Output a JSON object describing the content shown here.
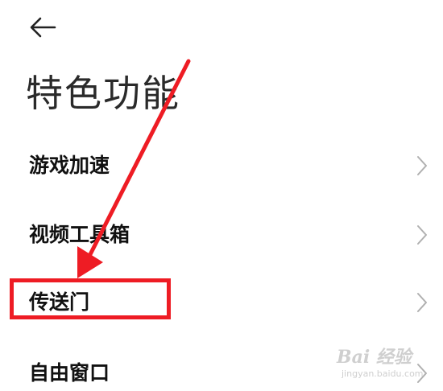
{
  "header": {
    "back_icon": "arrow-left-icon",
    "title": "特色功能"
  },
  "menu": {
    "items": [
      {
        "label": "游戏加速",
        "icon": "chevron-right-icon"
      },
      {
        "label": "视频工具箱",
        "icon": "chevron-right-icon"
      },
      {
        "label": "传送门",
        "icon": "chevron-right-icon",
        "highlighted": true
      },
      {
        "label": "自由窗口",
        "icon": "chevron-right-icon"
      }
    ]
  },
  "annotation": {
    "color": "#ee1c24"
  },
  "watermark": {
    "brand": "Bai 经验",
    "url": "jingyan.baidu.com"
  },
  "colors": {
    "background": "#ffffff",
    "text": "#111111",
    "chevron": "#b0b0b0",
    "highlight": "#ee1c24"
  }
}
